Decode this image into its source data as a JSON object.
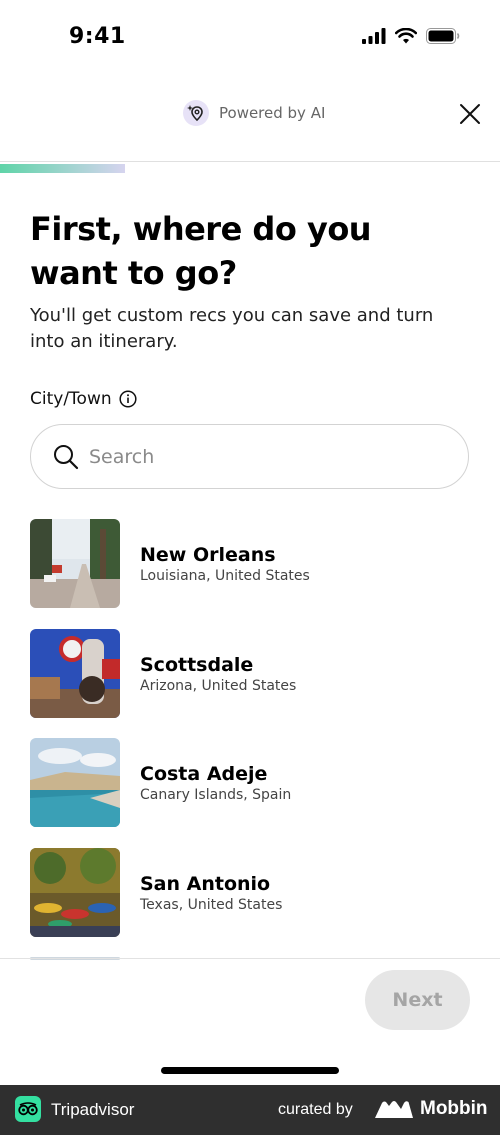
{
  "status_bar": {
    "time": "9:41"
  },
  "header": {
    "powered_label": "Powered by AI"
  },
  "progress": {
    "fraction": 0.25
  },
  "content": {
    "title": "First, where do you want to go?",
    "subtitle": "You'll get custom recs you can save and turn into an itinerary.",
    "field_label": "City/Town",
    "search_placeholder": "Search"
  },
  "results": [
    {
      "name": "New Orleans",
      "region": "Louisiana, United States"
    },
    {
      "name": "Scottsdale",
      "region": "Arizona, United States"
    },
    {
      "name": "Costa Adeje",
      "region": "Canary Islands, Spain"
    },
    {
      "name": "San Antonio",
      "region": "Texas, United States"
    }
  ],
  "footer": {
    "next_label": "Next"
  },
  "brand_bar": {
    "app_name": "Tripadvisor",
    "curated_label": "curated by",
    "curator_name": "Mobbin"
  },
  "colors": {
    "accent_green": "#34e0a1",
    "next_disabled_bg": "#e6e6e6",
    "brand_bar_bg": "#2f2f2f"
  },
  "icons": [
    "signal-icon",
    "wifi-icon",
    "battery-icon",
    "ai-pin-icon",
    "close-icon",
    "info-icon",
    "search-icon",
    "tripadvisor-owl-icon",
    "mobbin-logo-icon"
  ]
}
